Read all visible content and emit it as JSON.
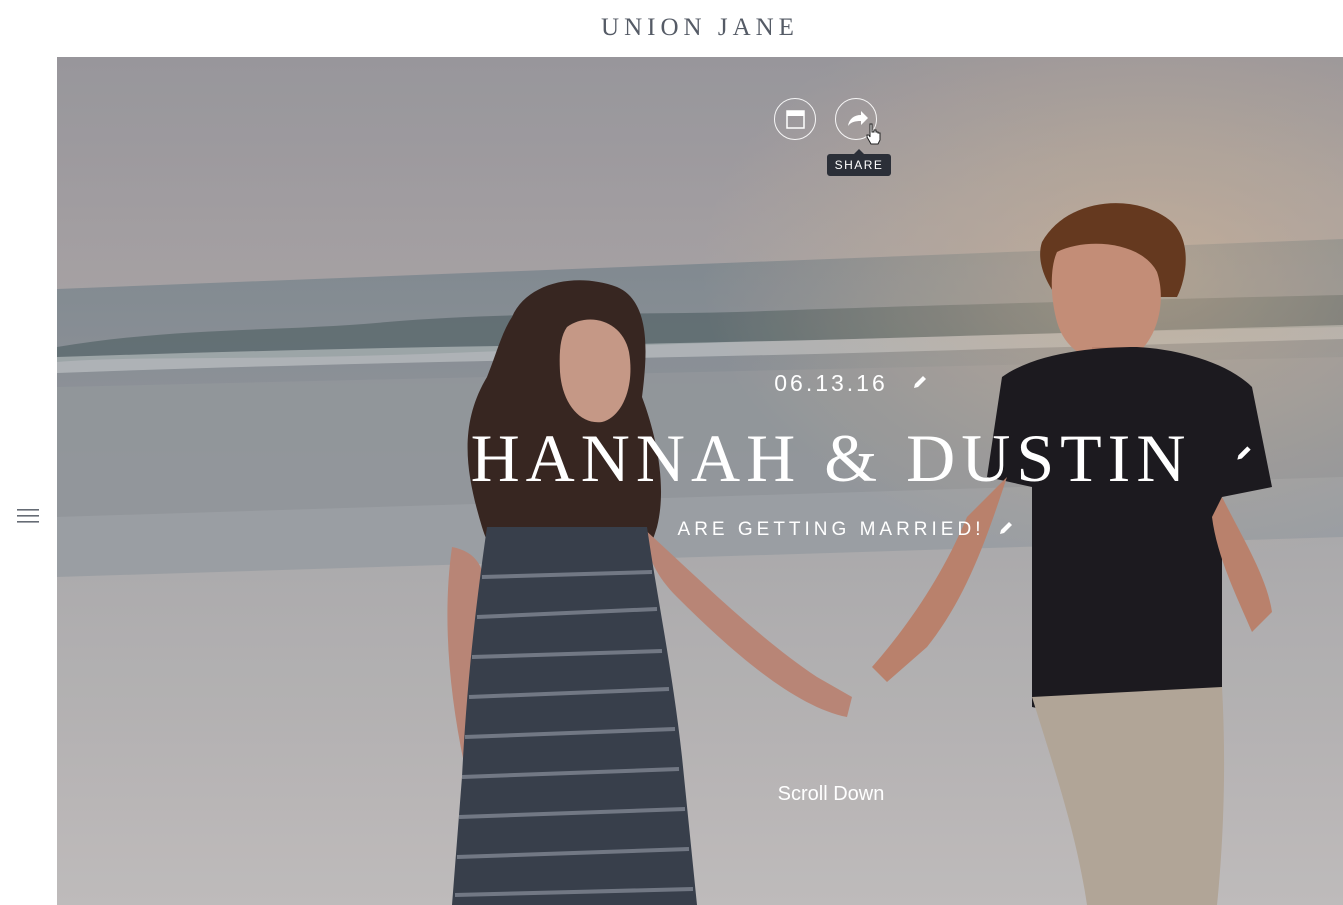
{
  "header": {
    "brand": "UNION JANE"
  },
  "sidebar": {
    "menu_icon": "hamburger-menu-icon"
  },
  "hero": {
    "toolbar": {
      "layout_icon": "window-layout-icon",
      "share_icon": "share-arrow-icon",
      "share_tooltip": "SHARE"
    },
    "date": "06.13.16",
    "names": "HANNAH & DUSTIN",
    "subtitle": "ARE GETTING MARRIED!",
    "edit_icon": "pencil-icon",
    "scroll_label": "Scroll Down"
  },
  "colors": {
    "brand_text": "#555b66",
    "tooltip_bg": "#2b2f38",
    "overlay_text": "#ffffff"
  }
}
